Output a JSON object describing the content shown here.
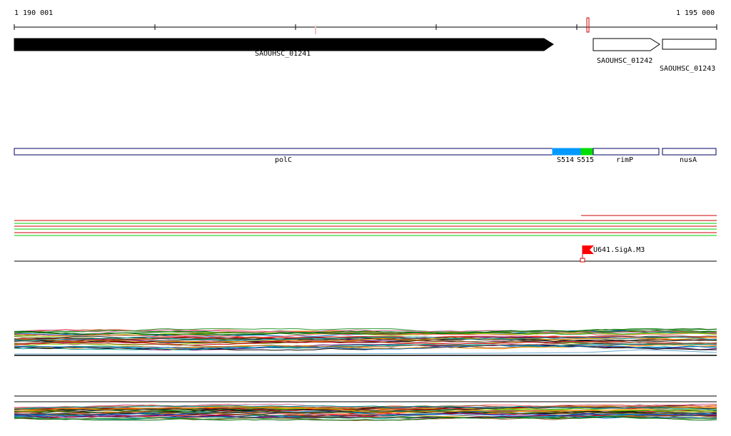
{
  "ruler": {
    "start_label": "1 190 001",
    "end_label": "1 195 000"
  },
  "genes": [
    {
      "label": "SAOUHSC_01241",
      "style": "filled"
    },
    {
      "label": "SAOUHSC_01242",
      "style": "outline"
    },
    {
      "label": "SAOUHSC_01243",
      "style": "outline"
    }
  ],
  "segments": [
    {
      "label": "polC",
      "color": "#ffffff"
    },
    {
      "label": "S514",
      "color": "#0099ff"
    },
    {
      "label": "S515",
      "color": "#00dd00"
    },
    {
      "label": "rimP",
      "color": "#ffffff"
    },
    {
      "label": "nusA",
      "color": "#ffffff"
    }
  ],
  "feature_lines": {
    "colors": [
      "#cc0000",
      "#00cc00",
      "#cc0000",
      "#00cc00",
      "#cc0000",
      "#00cc00"
    ]
  },
  "marker": {
    "label": "U641.SigA.M3",
    "color": "#ff0000"
  },
  "colors": {
    "outline": "#000066",
    "accent_red": "#cc0000",
    "accent_green": "#00cc00"
  }
}
